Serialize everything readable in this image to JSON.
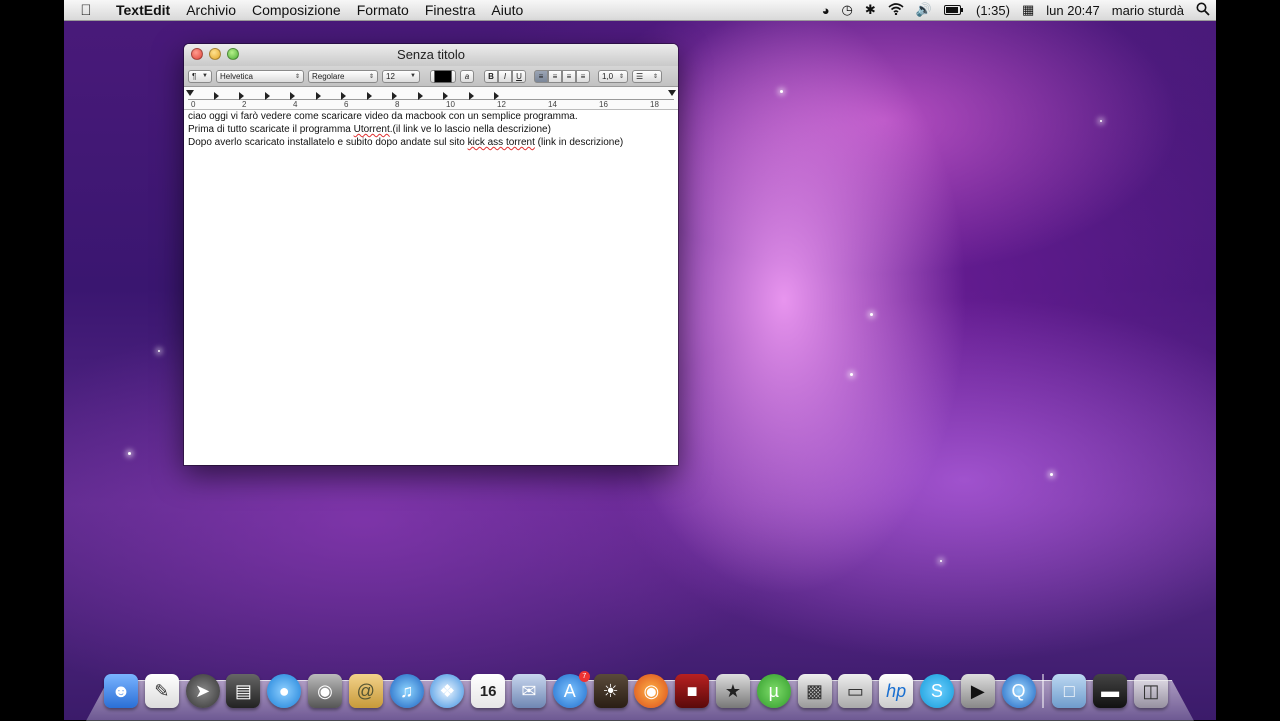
{
  "menubar": {
    "apple_icon": "apple-logo-icon",
    "app_name": "TextEdit",
    "menus": [
      "Archivio",
      "Composizione",
      "Formato",
      "Finestra",
      "Aiuto"
    ],
    "battery": "(1:35)",
    "clock": "lun 20:47",
    "user": "mario sturdà"
  },
  "window": {
    "title": "Senza titolo",
    "toolbar": {
      "paragraph": "¶",
      "font_family": "Helvetica",
      "font_style": "Regolare",
      "font_size": "12",
      "bold": "B",
      "italic": "I",
      "underline": "U",
      "spacing": "1,0"
    },
    "ruler_labels": [
      "0",
      "2",
      "4",
      "6",
      "8",
      "10",
      "12",
      "14",
      "16",
      "18"
    ],
    "document": {
      "line1": "ciao oggi vi farò vedere come scaricare video da macbook con un semplice programma.",
      "line2_a": "Prima di tutto scaricate il programma ",
      "line2_b": "Utorrent",
      "line2_c": ".(il link ve lo lascio nella descrizione)",
      "line3_a": "Dopo averlo scaricato installatelo e subito dopo andate sul sito ",
      "line3_b": "kick ass torrent",
      "line3_c": " (link in descrizione)"
    }
  },
  "dock": {
    "ical_day": "16",
    "appstore_badge": "7"
  }
}
